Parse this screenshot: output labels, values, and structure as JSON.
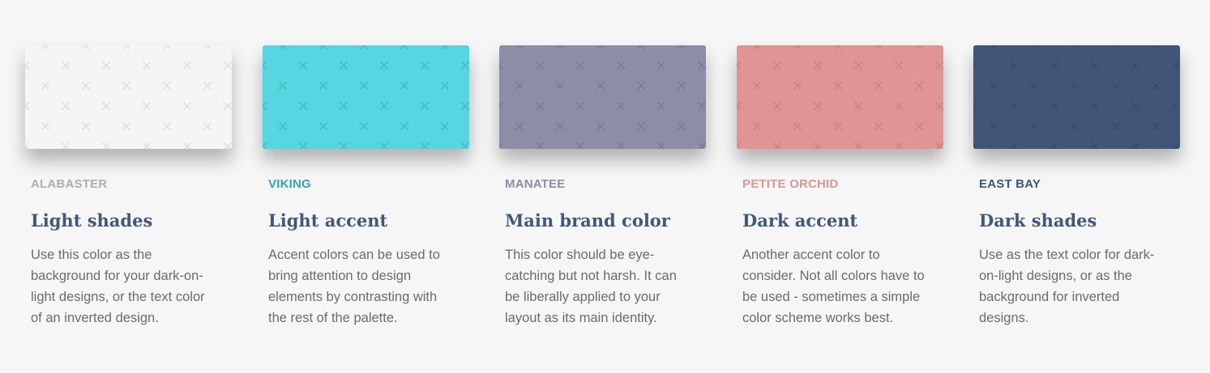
{
  "colors": [
    {
      "name": "ALABASTER",
      "hex": "#f5f5f5",
      "name_color": "#b3adad",
      "pattern_color": "#e2e2e2",
      "title": "Light shades",
      "description": "Use this color as the background for your dark-on-light designs, or the text color of an inverted design."
    },
    {
      "name": "VIKING",
      "hex": "#55d6e0",
      "name_color": "#36a3ad",
      "pattern_color": "#48bdc7",
      "title": "Light accent",
      "description": "Accent colors can be used to bring attention to design elements by contrasting with the rest of the palette."
    },
    {
      "name": "MANATEE",
      "hex": "#8d8ea5",
      "name_color": "#8d8ea5",
      "pattern_color": "#7d7e95",
      "title": "Main brand color",
      "description": "This color should be eye-catching but not harsh. It can be liberally applied to your layout as its main identity."
    },
    {
      "name": "PETITE ORCHID",
      "hex": "#de9593",
      "name_color": "#de9593",
      "pattern_color": "#cf8584",
      "title": "Dark accent",
      "description": "Another accent color to consider. Not all colors have to be used - sometimes a simple color scheme works best."
    },
    {
      "name": "EAST BAY",
      "hex": "#415677",
      "name_color": "#415677",
      "pattern_color": "#394d6c",
      "title": "Dark shades",
      "description": "Use as the text color for dark-on-light designs, or as the background for inverted designs."
    }
  ]
}
